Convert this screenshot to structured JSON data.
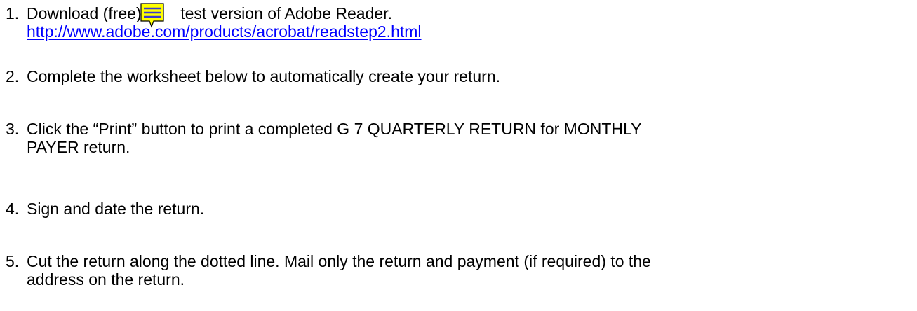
{
  "colors": {
    "link": "#0000ff",
    "note_fill": "#ffff00",
    "note_stroke": "#000000",
    "note_lines": "#3a3acc"
  },
  "note_icon": "sticky-note-comment-icon",
  "steps": [
    {
      "number": "1.",
      "text_before": "Download (free) th",
      "text_after": "test version of Adobe Reader.",
      "link": "http://www.adobe.com/products/acrobat/readstep2.html"
    },
    {
      "number": "2.",
      "text": "Complete the worksheet below to automatically create your return."
    },
    {
      "number": "3.",
      "line1": "Click the “Print” button to print a completed G 7  QUARTERLY RETURN for MONTHLY",
      "line2": "PAYER return."
    },
    {
      "number": "4.",
      "text": "Sign and date the return."
    },
    {
      "number": "5.",
      "line1": "Cut the return along the dotted line.  Mail only the return and payment (if required) to the",
      "line2": "address on the return."
    }
  ]
}
